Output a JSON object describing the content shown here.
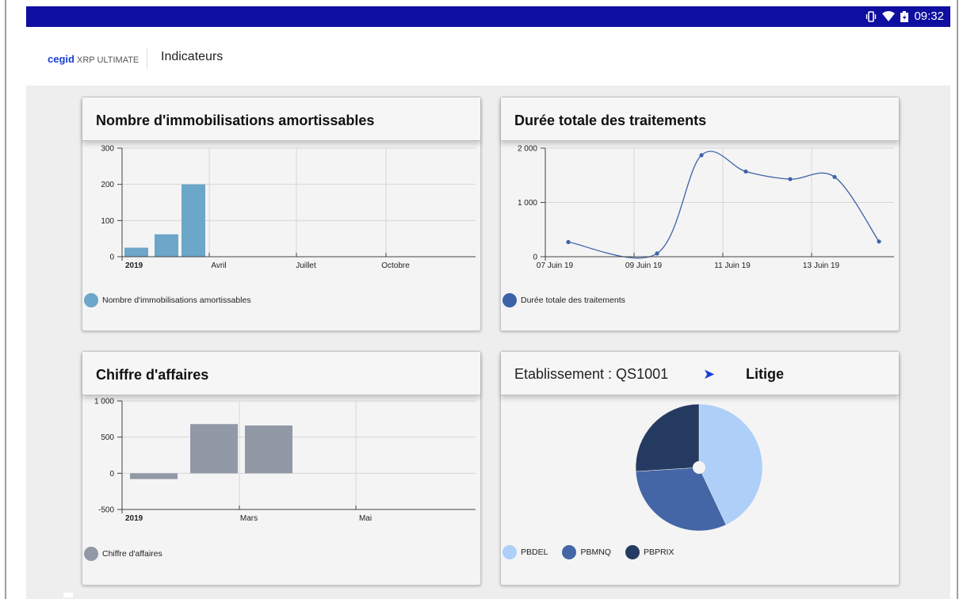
{
  "status_bar": {
    "time": "09:32",
    "icons": [
      "vibrate-icon",
      "wifi-icon",
      "battery-icon"
    ]
  },
  "app": {
    "brand": "cegid",
    "product": "XRP ULTIMATE",
    "title": "Indicateurs",
    "brand_color": "#1a3fd6"
  },
  "cards": [
    {
      "title": "Nombre d'immobilisations amortissables",
      "legend": "Nombre d'immobilisations amortissables",
      "color": "#6ca6c8",
      "chart_data": {
        "type": "bar",
        "x_ticks": [
          "2019",
          "Avril",
          "Juillet",
          "Octobre"
        ],
        "y_ticks": [
          "300",
          "200",
          "100",
          "0"
        ],
        "ylim": [
          0,
          300
        ],
        "bars": [
          {
            "x": "2019-01",
            "value": 25
          },
          {
            "x": "2019-02",
            "value": 62
          },
          {
            "x": "2019-03",
            "value": 200
          }
        ],
        "series": [
          {
            "name": "Nombre d'immobilisations amortissables"
          }
        ],
        "grid": true
      }
    },
    {
      "title": "Durée totale des traitements",
      "legend": "Durée totale des traitements",
      "color": "#3c63a8",
      "chart_data": {
        "type": "line",
        "x_ticks": [
          "07 Juin 19",
          "09 Juin 19",
          "11 Juin 19",
          "13 Juin 19"
        ],
        "y_ticks": [
          "2 000",
          "1 000",
          "0"
        ],
        "ylim": [
          0,
          2000
        ],
        "points": [
          {
            "x": "2019-06-07",
            "y": 270
          },
          {
            "x": "2019-06-09",
            "y": 60
          },
          {
            "x": "2019-06-10",
            "y": 1870
          },
          {
            "x": "2019-06-11",
            "y": 1570
          },
          {
            "x": "2019-06-12",
            "y": 1430
          },
          {
            "x": "2019-06-13",
            "y": 1470
          },
          {
            "x": "2019-06-14",
            "y": 280
          }
        ],
        "series": [
          {
            "name": "Durée totale des traitements"
          }
        ],
        "grid": true
      }
    },
    {
      "title": "Chiffre d'affaires",
      "legend": "Chiffre d'affaires",
      "color": "#9199a6",
      "chart_data": {
        "type": "bar",
        "x_ticks": [
          "2019",
          "Mars",
          "Mai"
        ],
        "y_ticks": [
          "1 000",
          "500",
          "0",
          "-500"
        ],
        "ylim": [
          -500,
          1000
        ],
        "bars": [
          {
            "x": "2019-01",
            "value": -80
          },
          {
            "x": "2019-02",
            "value": 680
          },
          {
            "x": "2019-03",
            "value": 660
          }
        ],
        "series": [
          {
            "name": "Chiffre d'affaires"
          }
        ],
        "grid": true
      }
    }
  ],
  "pie_card": {
    "label": "Etablissement : QS1001",
    "arrow": "➤",
    "target": "Litige",
    "chart_data": {
      "type": "pie",
      "slices": [
        {
          "name": "PBDEL",
          "value": 43,
          "color": "#aecff8"
        },
        {
          "name": "PBMNQ",
          "value": 31,
          "color": "#4466a6"
        },
        {
          "name": "PBPRIX",
          "value": 26,
          "color": "#253a60"
        }
      ]
    }
  }
}
